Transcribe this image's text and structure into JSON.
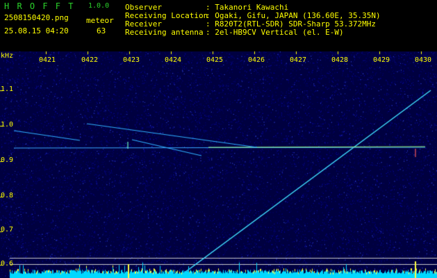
{
  "header": {
    "app_title": "H R O F F T",
    "version": "1.0.0",
    "filename": "2508150420.png",
    "datetime": "25.08.15 04:20",
    "type_label": "meteor",
    "count": "63",
    "labels": [
      "Observer",
      "Receiving Location",
      "Receiver",
      "Receiving antenna"
    ],
    "values": [
      ": Takanori Kawachi",
      ": Ogaki, Gifu, JAPAN (136.60E, 35.35N)",
      ": R820T2(RTL-SDR) SDR-Sharp 53.372MHz",
      ": 2el-HB9CV Vertical (el. E-W)"
    ]
  },
  "axes": {
    "y_unit": "kHz",
    "x_ticks": [
      "0421",
      "0422",
      "0423",
      "0424",
      "0425",
      "0426",
      "0427",
      "0428",
      "0429",
      "0430"
    ],
    "y_ticks": [
      "1.1",
      "1.0",
      "0.9",
      "0.8",
      "0.7",
      "0.6"
    ]
  },
  "colors": {
    "header_green": "#2bd32b",
    "header_yellow": "#ffff00",
    "background_blue": "#000060",
    "trace_cyan": "#40e0ff",
    "carrier_green": "#a0ff80"
  }
}
